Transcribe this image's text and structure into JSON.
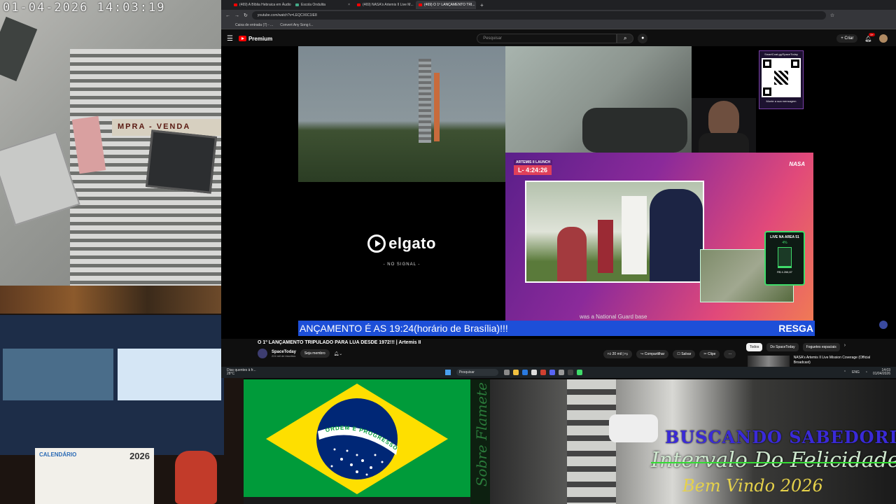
{
  "camera": {
    "timestamp": "01-04-2026 14:03:19",
    "sign_text": "MPRA - VENDA"
  },
  "desk_cam": {
    "calendar_label": "CALENDÁRIO",
    "calendar_year": "2026"
  },
  "browser": {
    "tabs": [
      {
        "label": "(469) A Bíblia Hebraica em Áudio"
      },
      {
        "label": "Escola Ondulita"
      },
      {
        "label": "(469) NASA's Artemis II Live M..."
      },
      {
        "label": "(469) O 1º LANÇAMENTO TRI..."
      }
    ],
    "new_tab": "+",
    "url": "youtube.com/watch?v=LEQCX6C1IE8",
    "bookmarks": [
      "Caixa de entrada (7) - ...",
      "Convert Any Song t..."
    ]
  },
  "youtube": {
    "logo": "Premium",
    "search_placeholder": "Pesquisar",
    "create_label": "+ Criar",
    "notif_count": "9+",
    "video_title": "O 1º LANÇAMENTO TRIPULADO PARA LUA DESDE 1972!!! | Artemis II",
    "channel_name": "SpaceToday",
    "channel_subs": "224 mil de inscritos",
    "join_label": "Seja membro",
    "like_count": "20 mil",
    "share_label": "Compartilhar",
    "save_label": "Salvar",
    "clip_label": "Clipe",
    "more_label": "···",
    "chips": [
      "Todos",
      "Do SpaceToday",
      "Foguetes espaciais"
    ],
    "related_title": "NASA's Artemis II Live Mission Coverage (Official Broadcast)"
  },
  "stream": {
    "qr_top": "SmartCoat.gg/SpaceToday",
    "qr_bottom": "Monte a sua mensagem",
    "elgato_logo": "elgato",
    "elgato_status": "- NO SIGNAL -",
    "artemis_tag": "ARTEMIS II LAUNCH",
    "countdown": "L- 4:24:26",
    "nasa_logo": "NASA",
    "subtitle": "was a National Guard base",
    "live51": {
      "title": "LIVE NA AREA 51",
      "percent": "4%",
      "progress": 0.04,
      "amount": "R$ 4.266,67"
    },
    "ticker_left": "ANÇAMENTO É AS 19:24(horário de Brasília)!!!",
    "ticker_right": "RESGA"
  },
  "taskbar": {
    "weather_title": "Dias quentes à fr...",
    "weather_temp": "28°C",
    "search_placeholder": "Pesquisar",
    "lang": "ENG",
    "time": "14:03",
    "date": "01/04/2026"
  },
  "flag": {
    "motto": "ORDEM E PROGRESSO"
  },
  "overlay": {
    "vertical": "Sobre Flamete",
    "line1": "BUSCANDO SABEDORIA",
    "line2": "Intervalo Do Felicidade",
    "line3": "Bem Vindo 2026"
  },
  "colors": {
    "yt_red": "#ff0000",
    "ticker_blue": "#1d4fd8",
    "live_green": "#3fdc6a",
    "flag_green": "#009b3a",
    "flag_yellow": "#fedf00",
    "flag_blue": "#002776"
  }
}
